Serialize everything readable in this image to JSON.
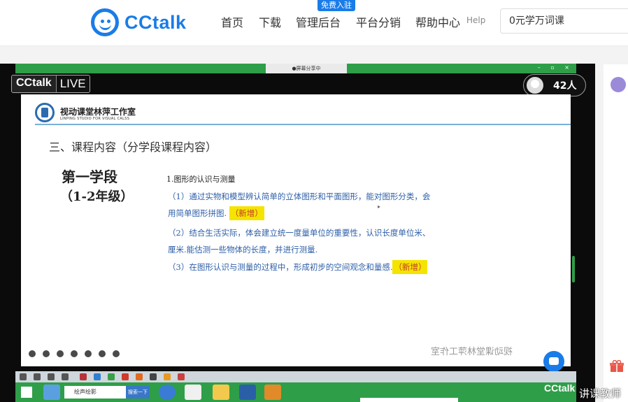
{
  "header": {
    "logo_text": "CCtalk",
    "badge_free": "免费入驻",
    "nav": [
      "首页",
      "下载",
      "管理后台",
      "平台分销",
      "帮助中心"
    ],
    "help": "Help",
    "search_value": "0元学万词课"
  },
  "video": {
    "share_label": "●屏幕分享中",
    "cc_label": "CCtalk",
    "live_label": "LIVE",
    "viewer_count": "42人"
  },
  "slide": {
    "studio_cn": "视动课堂林萍工作室",
    "studio_en": "LINPING STUDIO FOR VISUAL CALSS",
    "section": "三、课程内容（分学段课程内容）",
    "stage_title": "第一学段",
    "stage_grade": "（1-2年级）",
    "item_title": "1.图形的认识与测量",
    "lines": [
      "（1）通过实物和模型辨认简单的立体图形和平面图形，能对图形分类，会",
      "用简单图形拼图.",
      "（2）结合生活实际，体会建立统一度量单位的重要性，认识长度单位米、",
      "厘米.能估测一些物体的长度，并进行测量.",
      "（3）在图形认识与测量的过程中，形成初步的空间观念和量感."
    ],
    "new_tag": "（新增）",
    "watermark": "视动课堂林萍工作室"
  },
  "taskbar": {
    "search_text": "绘声绘影",
    "search_button": "搜索一下"
  },
  "overlay": {
    "cctalk": "CCtalk",
    "teacher": "讲课教师"
  },
  "colors": {
    "brand": "#1a7ce8",
    "frame_green": "#2f9e48",
    "text_blue": "#2e5fa8",
    "highlight": "#f5e300"
  }
}
